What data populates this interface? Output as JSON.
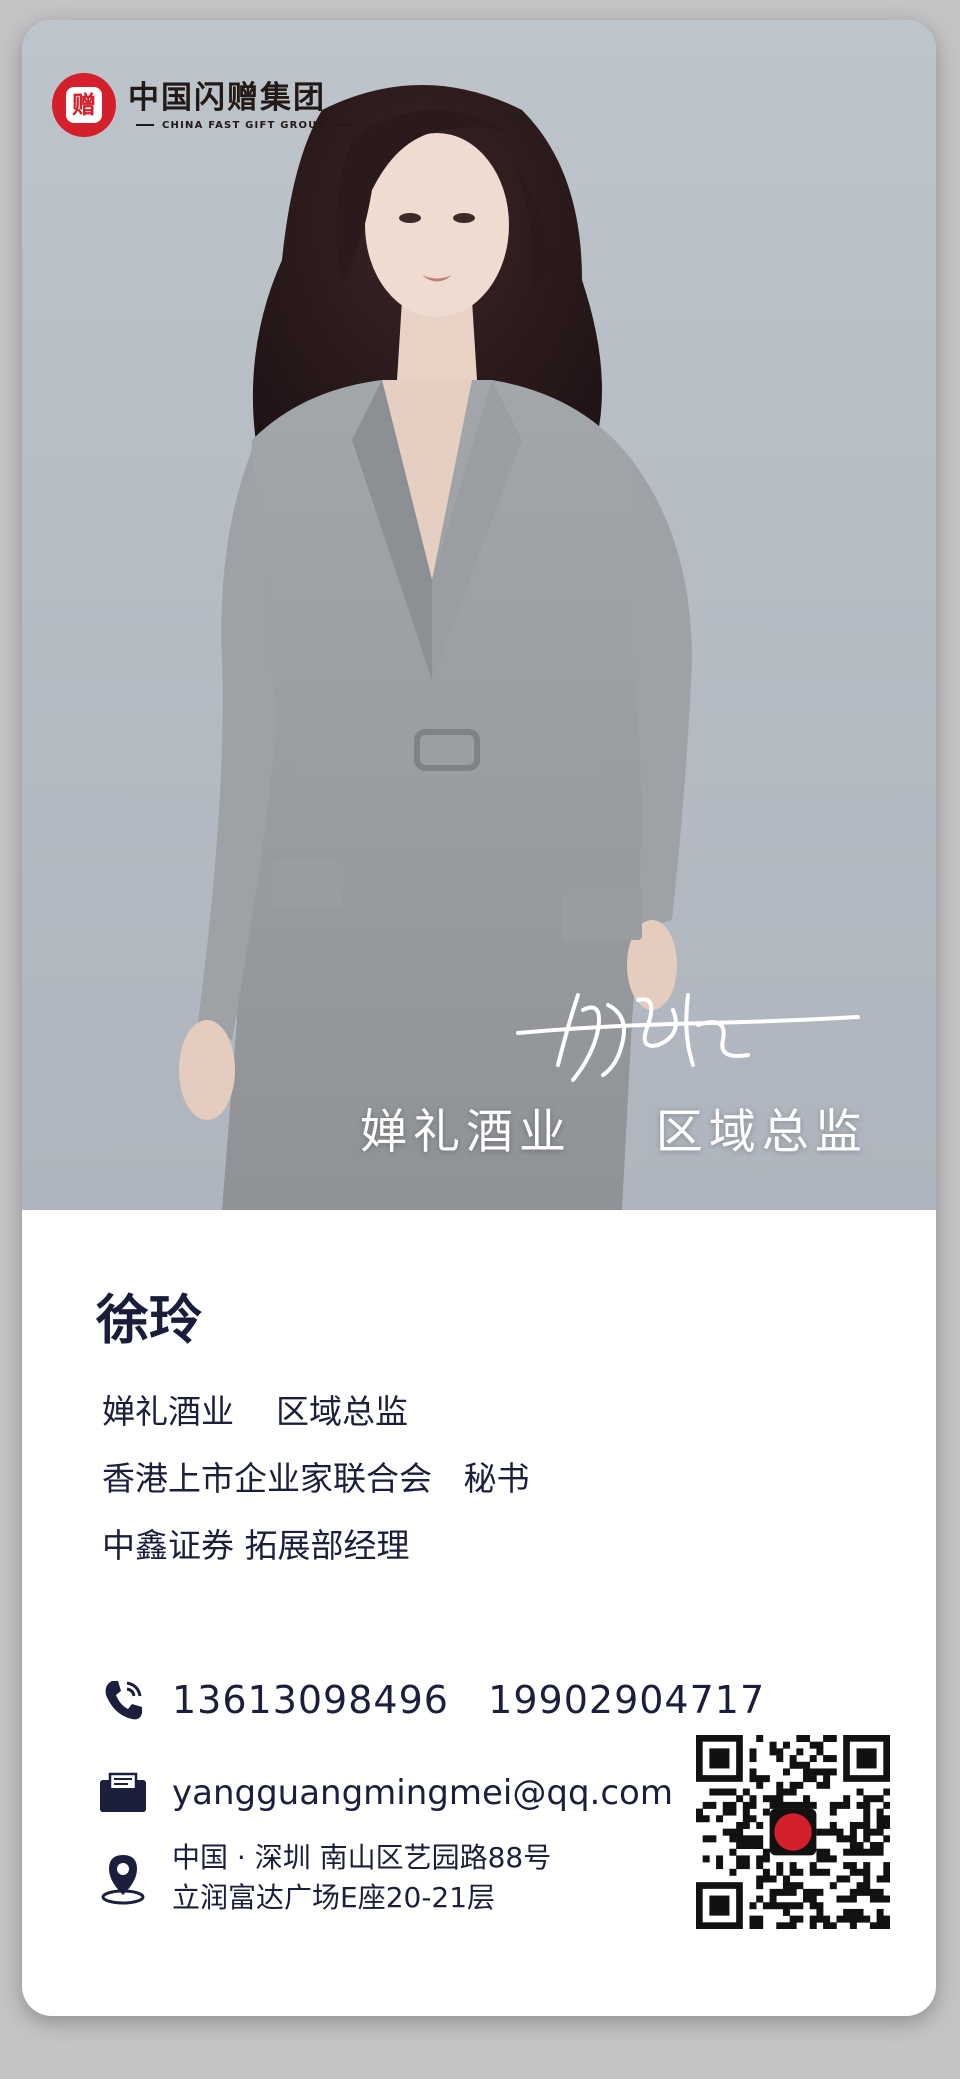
{
  "logo": {
    "mark_char": "赠",
    "name_cn": "中国闪赠集团",
    "name_en": "CHINA FAST GIFT GROUP"
  },
  "photo": {
    "title": "婵礼酒业    区域总监",
    "signature_alt": "handwritten signature"
  },
  "profile": {
    "name": "徐玲",
    "roles": [
      "婵礼酒业    区域总监",
      "香港上市企业家联合会   秘书",
      "中鑫证券 拓展部经理"
    ]
  },
  "contact": {
    "phones": "13613098496   19902904717",
    "email": "yangguangmingmei@qq.com",
    "address_line1": "中国 · 深圳 南山区艺园路88号",
    "address_line2": "立润富达广场E座20-21层",
    "icons": [
      "phone-icon",
      "mailbox-icon",
      "location-pin-icon"
    ]
  },
  "colors": {
    "brand_red": "#d4202a",
    "text_navy": "#1c1f3c",
    "card_bg": "#ffffff"
  }
}
